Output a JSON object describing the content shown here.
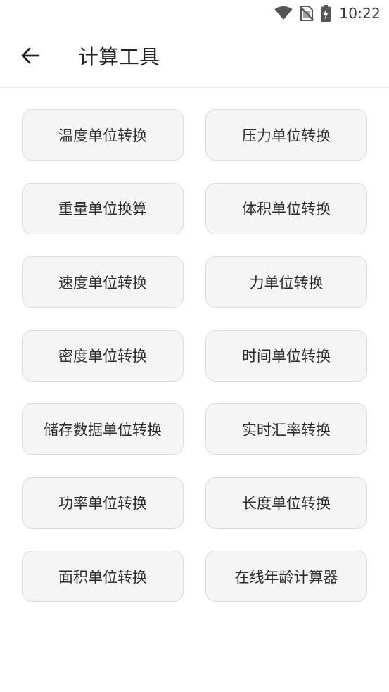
{
  "status_bar": {
    "time": "10:22",
    "icons": [
      "wifi-icon",
      "no-sim-icon",
      "battery-charging-icon"
    ]
  },
  "toolbar": {
    "back_icon": "arrow-left-icon",
    "title": "计算工具"
  },
  "tools": [
    {
      "label": "温度单位转换"
    },
    {
      "label": "压力单位转换"
    },
    {
      "label": "重量单位换算"
    },
    {
      "label": "体积单位转换"
    },
    {
      "label": "速度单位转换"
    },
    {
      "label": "力单位转换"
    },
    {
      "label": "密度单位转换"
    },
    {
      "label": "时间单位转换"
    },
    {
      "label": "储存数据单位转换"
    },
    {
      "label": "实时汇率转换"
    },
    {
      "label": "功率单位转换"
    },
    {
      "label": "长度单位转换"
    },
    {
      "label": "面积单位转换"
    },
    {
      "label": "在线年龄计算器"
    }
  ],
  "colors": {
    "background": "#ffffff",
    "button_fill": "#f5f5f5",
    "button_border": "#dcdcdc",
    "text": "#222222"
  }
}
